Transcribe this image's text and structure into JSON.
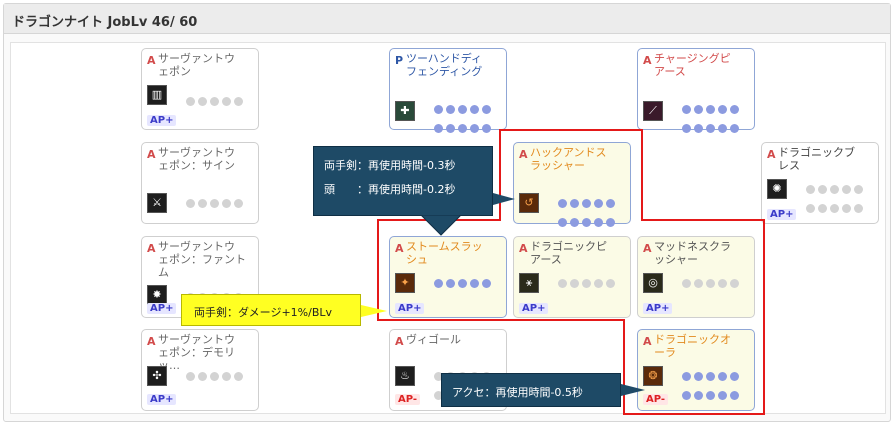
{
  "title": "ドラゴンナイト JobLv 46/ 60",
  "cards": {
    "c1": {
      "type": "A",
      "name": "サーヴァントウ\nェポン",
      "icon": "weapon-rack-icon",
      "dots": [
        0,
        0,
        0,
        0,
        0
      ],
      "badge": "AP+"
    },
    "c2": {
      "type": "P",
      "name": "ツーハンドディ\nフェンディング",
      "icon": "defense-swords-icon",
      "dots": [
        1,
        1,
        1,
        1,
        1,
        1,
        1,
        1,
        1,
        1
      ]
    },
    "c3": {
      "type": "A",
      "name": "チャージングピ\nアース",
      "icon": "spear-charge-icon",
      "dots": [
        1,
        1,
        1,
        1,
        1,
        1,
        1,
        1,
        1,
        1
      ]
    },
    "c4": {
      "type": "A",
      "name": "サーヴァントウ\nェポン：サイン",
      "icon": "sign-weapon-icon",
      "dots": [
        0,
        0,
        0,
        0,
        0
      ]
    },
    "c5": {
      "type": "A",
      "name": "ハックアンドス\nラッシャー",
      "icon": "hack-slash-icon",
      "dots": [
        1,
        1,
        1,
        1,
        1,
        1,
        1,
        1,
        1,
        1
      ]
    },
    "c6": {
      "type": "A",
      "name": "ドラゴニックブ\nレス",
      "icon": "dragon-breath-icon",
      "dots": [
        0,
        0,
        0,
        0,
        0,
        0,
        0,
        0,
        0,
        0
      ],
      "badge": "AP+"
    },
    "c7": {
      "type": "A",
      "name": "サーヴァントウ\nェポン：ファントム",
      "icon": "phantom-icon",
      "dots": [
        0,
        0,
        0,
        0,
        0
      ],
      "badge": "AP+"
    },
    "c8": {
      "type": "A",
      "name": "ストームスラッ\nシュ",
      "icon": "storm-slash-icon",
      "dots": [
        1,
        1,
        1,
        1,
        1
      ],
      "badge": "AP+"
    },
    "c9": {
      "type": "A",
      "name": "ドラゴニックピ\nアース",
      "icon": "dragon-pierce-icon",
      "dots": [
        0,
        0,
        0,
        0,
        0
      ],
      "badge": "AP+"
    },
    "c10": {
      "type": "A",
      "name": "マッドネスクラ\nッシャー",
      "icon": "madness-crusher-icon",
      "dots": [
        0,
        0,
        0,
        0,
        0
      ],
      "badge": "AP+"
    },
    "c11": {
      "type": "A",
      "name": "サーヴァントウ\nェポン：デモリッ…",
      "icon": "demolition-icon",
      "dots": [
        0,
        0,
        0,
        0,
        0
      ],
      "badge": "AP+"
    },
    "c12": {
      "type": "A",
      "name": "ヴィゴール",
      "icon": "vigor-icon",
      "dots": [
        0,
        0,
        0,
        0,
        0,
        0,
        0,
        0,
        0,
        0
      ],
      "badge": "AP-"
    },
    "c13": {
      "type": "A",
      "name": "ドラゴニックオ\nーラ",
      "icon": "dragon-aura-icon",
      "dots": [
        1,
        1,
        1,
        1,
        1,
        1,
        1,
        1,
        1,
        1
      ],
      "badge": "AP-"
    }
  },
  "tooltips": {
    "t1": {
      "line1": "両手剣：再使用時間-0.3秒",
      "line2": "頭　　：再使用時間-0.2秒"
    },
    "t2": {
      "line1": "両手剣：ダメージ+1%/BLv"
    },
    "t3": {
      "line1": "アクセ：再使用時間-0.5秒"
    }
  },
  "colors": {
    "red_outline": "#e41919",
    "tooltip_dark": "#1e4a66",
    "tooltip_yellow": "#ffff22",
    "dot_on": "#8c9be0",
    "dot_off": "#d3d3d3"
  }
}
